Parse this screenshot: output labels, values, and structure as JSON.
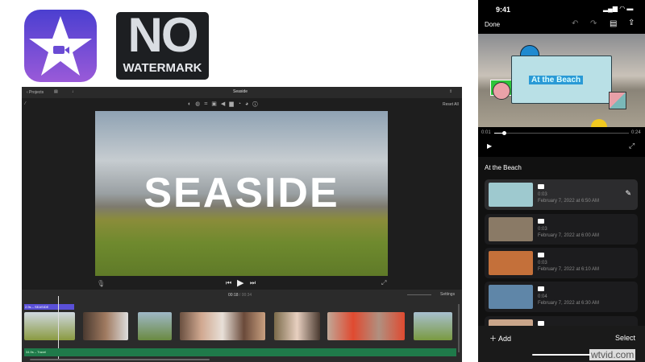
{
  "logos": {
    "app_icon": "imovie-star-camera-icon",
    "badge_no": "NO",
    "badge_watermark": "WATERMARK"
  },
  "mac": {
    "back_label": "‹ Projects",
    "window_title": "Seaside",
    "reset_all": "Reset All",
    "viewer_title": "SEASIDE",
    "time_current": "00:18",
    "time_separator": "/",
    "time_total": "00:34",
    "settings": "Settings",
    "title_clip_label": "2.9s – SEASIDE",
    "audio_clip_label": "34.9s – Travel"
  },
  "phone": {
    "time": "9:41",
    "done": "Done",
    "overlay_title": "At the Beach",
    "scrub_start": "0:01",
    "scrub_end": "0:24",
    "section_title": "At the Beach",
    "items": [
      {
        "duration": "0:03",
        "date": "February 7, 2022 at 6:50 AM",
        "thumb": "#9ec9cf"
      },
      {
        "duration": "0:03",
        "date": "February 7, 2022 at 6:00 AM",
        "thumb": "#8a7a66"
      },
      {
        "duration": "0:03",
        "date": "February 7, 2022 at 6:10 AM",
        "thumb": "#c4703a"
      },
      {
        "duration": "0:04",
        "date": "February 7, 2022 at 6:30 AM",
        "thumb": "#5f86a8"
      },
      {
        "duration": "0:03",
        "date": "",
        "thumb": "#c9a58a"
      }
    ],
    "add": "Add",
    "select": "Select"
  },
  "watermark": "wtvid.com"
}
